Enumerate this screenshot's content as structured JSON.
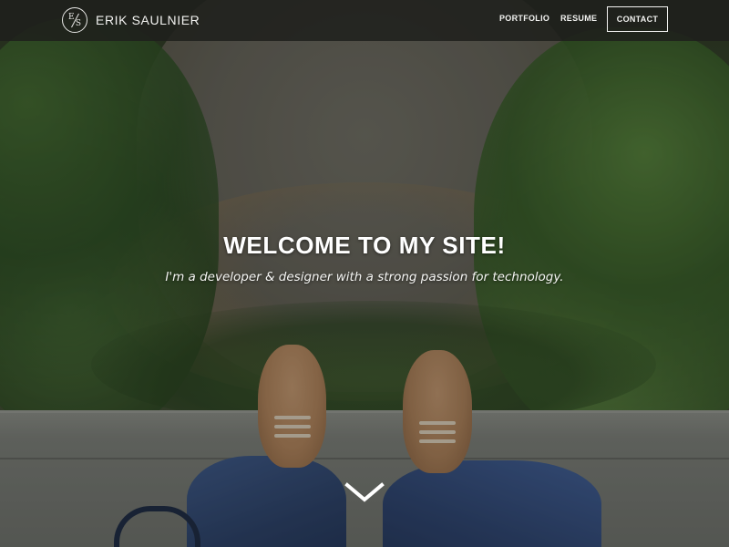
{
  "nav": {
    "logo_left_letter": "E",
    "logo_right_letter": "S",
    "brand": "ERIK SAULNIER",
    "links": [
      {
        "label": "PORTFOLIO"
      },
      {
        "label": "RESUME"
      }
    ],
    "contact_label": "CONTACT"
  },
  "hero": {
    "title": "WELCOME TO MY SITE!",
    "subtitle": "I'm a developer & designer with a strong passion for technology.",
    "scroll_icon": "chevron-down-icon",
    "background": "photo of sneakers on a curb above gravel and plants"
  },
  "colors": {
    "nav_bg": "#1e1f1c",
    "text": "#ffffff"
  }
}
